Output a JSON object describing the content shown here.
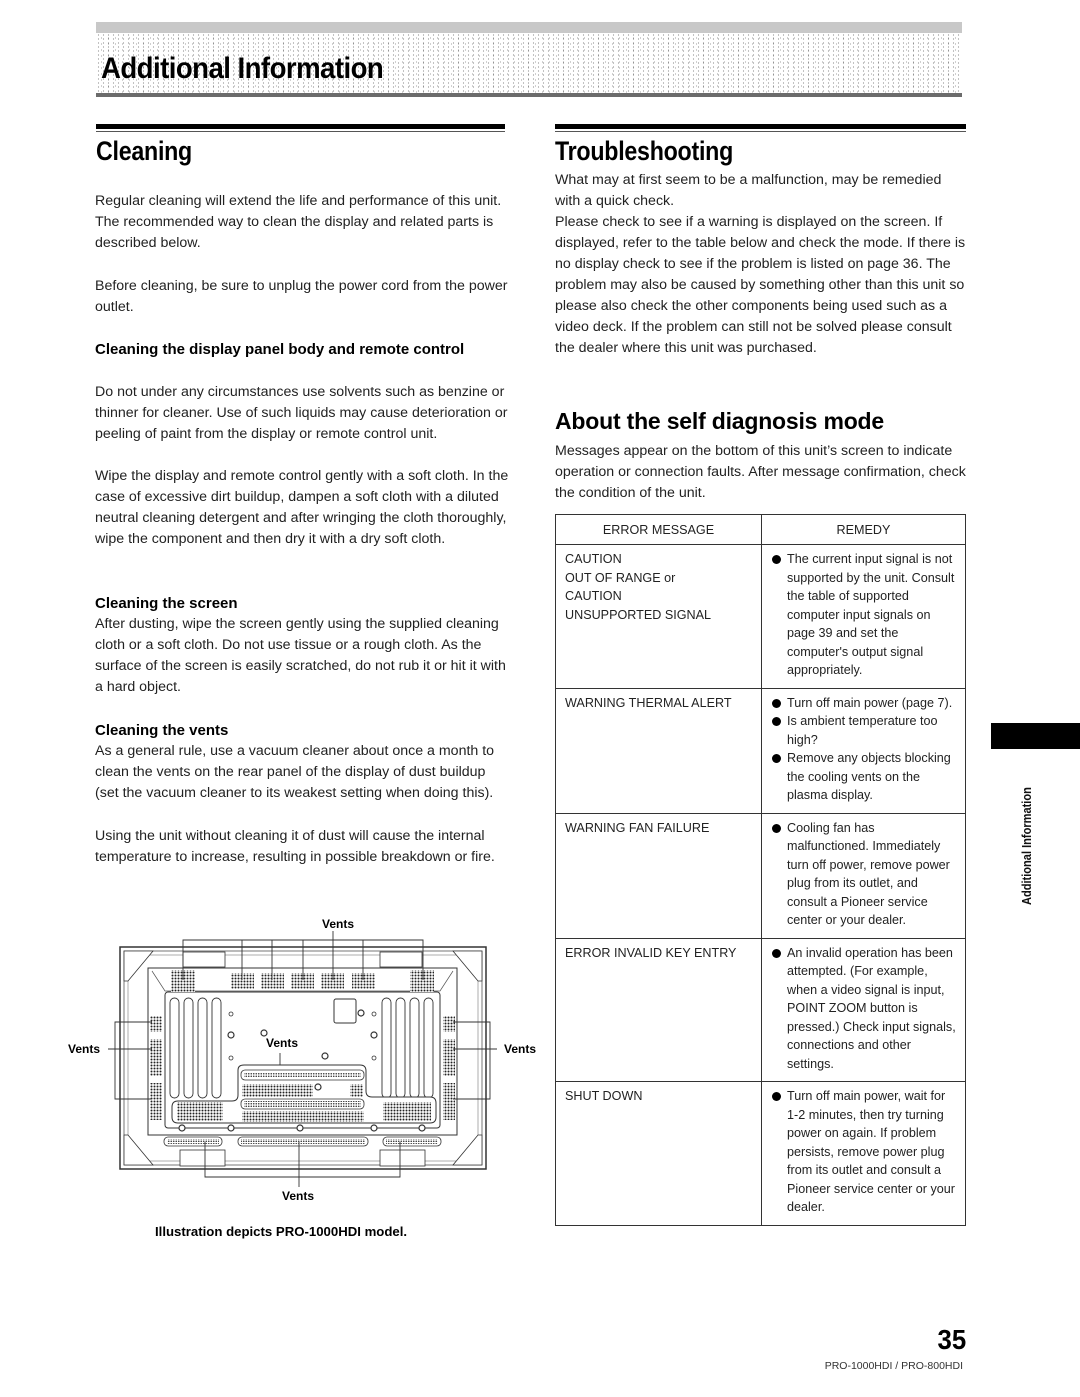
{
  "banner": {
    "title": "Additional Information"
  },
  "cleaning": {
    "title": "Cleaning",
    "intro": "Regular cleaning will extend the life and performance of this unit. The recommended way to clean the display and related parts is described below.",
    "before": "Before cleaning, be sure to unplug the power cord from the power outlet.",
    "subsections": [
      {
        "heading": "Cleaning the display panel body and remote control",
        "paragraphs": [
          "Do not under any circumstances use solvents such as benzine or thinner for cleaner. Use of such liquids may cause deterioration or peeling of paint from the display or remote control unit.",
          "Wipe the display and remote control gently with a soft cloth. In the case of excessive dirt buildup, dampen a soft cloth with a diluted neutral cleaning detergent and after wringing the cloth thoroughly, wipe the component and then dry it with a dry soft cloth."
        ]
      },
      {
        "heading": "Cleaning the screen",
        "paragraphs": [
          "After dusting, wipe the screen gently using the supplied cleaning cloth or a soft cloth. Do not use tissue or a rough cloth. As the surface of the screen is easily scratched, do not rub it or hit it with a hard object."
        ]
      },
      {
        "heading": "Cleaning the vents",
        "paragraphs": [
          "As a general rule, use a vacuum cleaner about once a month to clean the vents on the rear panel of the display of dust buildup (set the vacuum cleaner to its weakest setting when doing this).",
          "Using the unit without cleaning it of dust will cause the internal temperature to increase, resulting in possible breakdown or fire."
        ]
      }
    ],
    "illustration": {
      "labels": {
        "top": "Vents",
        "left": "Vents",
        "center": "Vents",
        "right": "Vents",
        "bottom": "Vents"
      },
      "caption": "Illustration depicts PRO-1000HDI model."
    }
  },
  "troubleshooting": {
    "title": "Troubleshooting",
    "paragraphs": [
      "What may at first seem to be a malfunction, may be remedied with a quick check.",
      "Please check to see if a warning is displayed on the screen. If displayed, refer to the table below and check the mode. If there is no display check to see if the problem is listed on page 36. The problem may also be caused by something other than this unit so please also check the other components being used such as a video deck. If the problem can still not be solved please consult the dealer where this unit was purchased."
    ]
  },
  "self_diagnosis": {
    "title": "About the self diagnosis mode",
    "intro": "Messages appear on the bottom of this unit’s screen to indicate operation or connection faults. After message confirmation, check the condition of the unit.",
    "table": {
      "headers": [
        "ERROR MESSAGE",
        "REMEDY"
      ],
      "rows": [
        {
          "message_lines": [
            "CAUTION",
            "OUT OF RANGE or",
            "CAUTION",
            "UNSUPPORTED SIGNAL"
          ],
          "remedies": [
            "The current input signal is not supported by the unit. Consult the table of supported computer input signals on page 39 and set the computer's output signal appropriately."
          ]
        },
        {
          "message_lines": [
            "WARNING THERMAL ALERT"
          ],
          "remedies": [
            "Turn off main power (page 7).",
            "Is ambient temperature too high?",
            "Remove any objects blocking the cooling vents on the plasma display."
          ]
        },
        {
          "message_lines": [
            "WARNING FAN FAILURE"
          ],
          "remedies": [
            "Cooling fan has malfunctioned. Immediately turn off power, remove power plug from its outlet, and consult a Pioneer service center or your dealer."
          ]
        },
        {
          "message_lines": [
            "ERROR INVALID KEY ENTRY"
          ],
          "remedies": [
            "An invalid operation has been attempted. (For example, when a video signal is input, POINT ZOOM button is pressed.) Check input signals, connections and other settings."
          ]
        },
        {
          "message_lines": [
            "SHUT DOWN"
          ],
          "remedies": [
            "Turn off main power, wait for 1-2 minutes, then try turning power on again. If problem persists, remove power plug from its outlet and consult a Pioneer service center or your dealer."
          ]
        }
      ]
    }
  },
  "side_tab": {
    "label": "Additional Information"
  },
  "footer": {
    "page_number": "35",
    "models": "PRO-1000HDI / PRO-800HDI"
  }
}
